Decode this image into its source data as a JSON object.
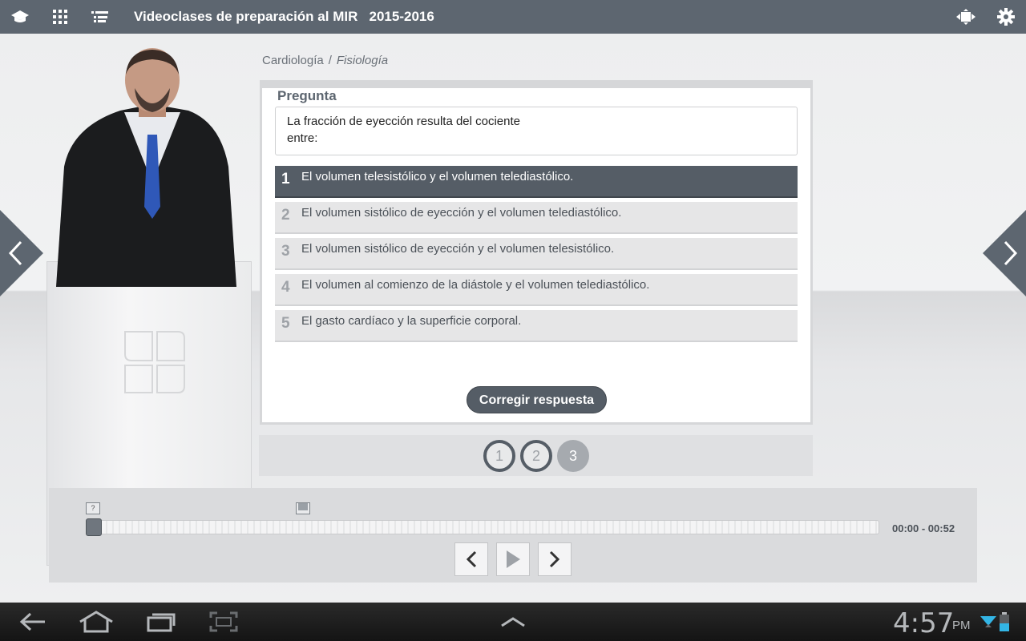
{
  "topbar": {
    "title": "Videoclases de preparación al MIR   2015-2016",
    "icons": [
      "graduation-cap-icon",
      "grid-icon",
      "list-icon",
      "fullscreen-icon",
      "gear-icon"
    ]
  },
  "breadcrumb": {
    "section": "Cardiología",
    "separator": "/",
    "subsection": "Fisiología"
  },
  "question": {
    "heading": "Pregunta",
    "text": "La fracción de eyección resulta del cociente\nentre:",
    "options": [
      {
        "number": "1",
        "text": "El volumen telesistólico y el volumen telediastólico.",
        "selected": true
      },
      {
        "number": "2",
        "text": "El volumen sistólico de eyección y el volumen telediastólico.",
        "selected": false
      },
      {
        "number": "3",
        "text": "El volumen sistólico de eyección y el volumen telesistólico.",
        "selected": false
      },
      {
        "number": "4",
        "text": "El volumen al comienzo de la diástole y el volumen telediastólico.",
        "selected": false
      },
      {
        "number": "5",
        "text": "El gasto cardíaco y la superficie corporal.",
        "selected": false
      }
    ],
    "check_button": "Corregir respuesta"
  },
  "pager": {
    "pages": [
      {
        "label": "1",
        "state": "done"
      },
      {
        "label": "2",
        "state": "done"
      },
      {
        "label": "3",
        "state": "current"
      }
    ]
  },
  "player": {
    "marker_question": "?",
    "time": "00:00 - 00:52",
    "progress": 0
  },
  "system": {
    "time": "4:57",
    "ampm": "PM"
  },
  "colors": {
    "topbar": "#5d6670",
    "selected_option": "#555d66",
    "option_bg": "#e6e6e7"
  }
}
